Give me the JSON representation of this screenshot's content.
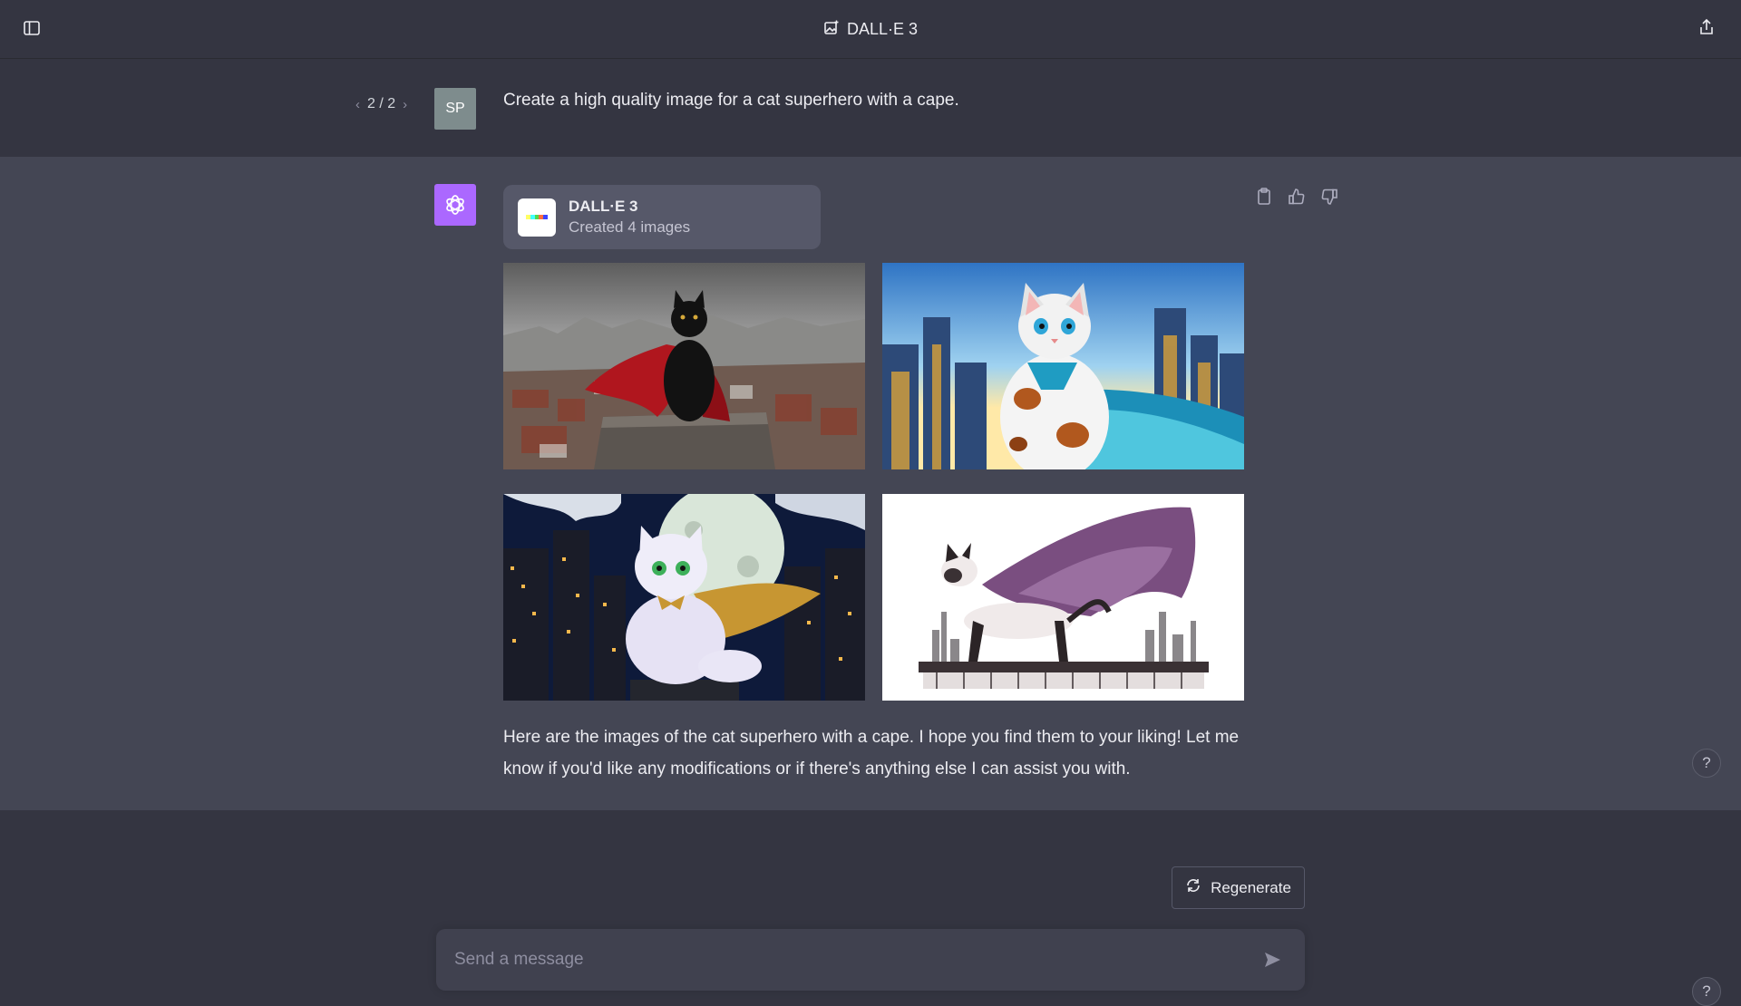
{
  "header": {
    "title": "DALL·E 3",
    "title_icon": "image-sparkle-icon",
    "left_icon": "sidebar-toggle-icon",
    "right_icon": "share-icon"
  },
  "user_message": {
    "pager": "2 / 2",
    "avatar_initials": "SP",
    "text": "Create a high quality image for a cat superhero with a cape."
  },
  "assistant_message": {
    "tool_card": {
      "name": "DALL·E 3",
      "status": "Created 4 images"
    },
    "actions": [
      "copy-icon",
      "thumbs-up-icon",
      "thumbs-down-icon"
    ],
    "images": [
      "black cat with red cape on rooftop",
      "cartoon calico cat superhero with teal cape",
      "white fluffy cat with golden cape under full moon",
      "siamese cat with purple cape on ledge, ink sketch"
    ],
    "text": "Here are the images of the cat superhero with a cape. I hope you find them to your liking! Let me know if you'd like any modifications or if there's anything else I can assist you with."
  },
  "composer": {
    "regenerate_label": "Regenerate",
    "placeholder": "Send a message"
  },
  "help_label": "?",
  "colors": {
    "background": "#343541",
    "assistant_bg": "#444654",
    "accent_bot": "#ab68ff"
  }
}
